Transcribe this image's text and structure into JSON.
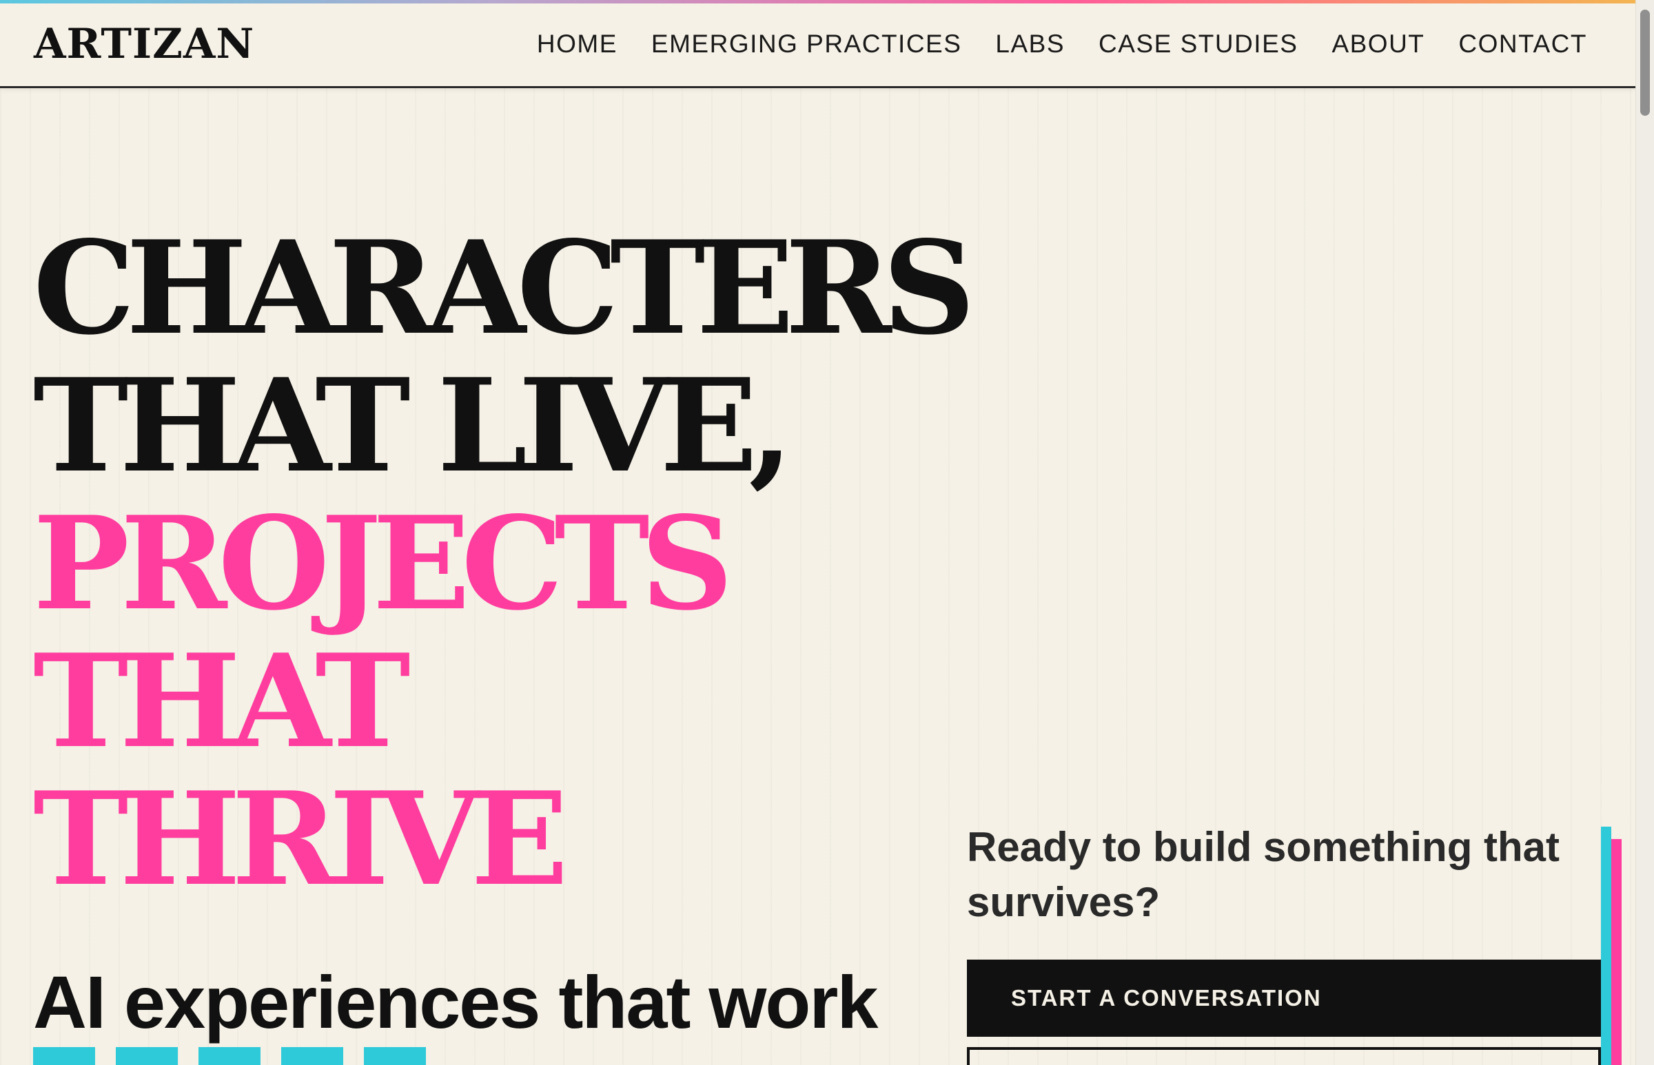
{
  "brand": {
    "logo": "ARTIZAN"
  },
  "nav": {
    "items": [
      "HOME",
      "EMERGING PRACTICES",
      "LABS",
      "CASE STUDIES",
      "ABOUT",
      "CONTACT"
    ]
  },
  "hero": {
    "lines": [
      {
        "text": "CHARACTERS",
        "color": "dark"
      },
      {
        "text": "THAT LIVE,",
        "color": "dark"
      },
      {
        "text": "PROJECTS",
        "color": "pink"
      },
      {
        "text": "THAT",
        "color": "pink"
      },
      {
        "text": "THRIVE",
        "color": "pink"
      }
    ],
    "subhead": "AI experiences that work"
  },
  "cta": {
    "heading": "Ready to build something that survives?",
    "primary_button": "START A CONVERSATION"
  },
  "colors": {
    "background": "#f5f1e6",
    "text": "#111111",
    "accent_pink": "#ff3d9e",
    "accent_cyan": "#2ecad9"
  },
  "icons": [
    "scrollbar-thumb"
  ]
}
